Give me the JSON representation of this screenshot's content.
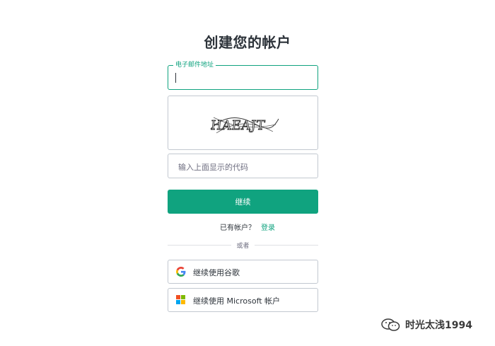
{
  "page": {
    "title": "创建您的帐户"
  },
  "email": {
    "label": "电子邮件地址",
    "value": ""
  },
  "captcha": {
    "text": "HAEAJT"
  },
  "code": {
    "placeholder": "输入上面显示的代码"
  },
  "actions": {
    "continue_label": "继续",
    "have_account_text": "已有帐户？",
    "login_label": "登录"
  },
  "divider": {
    "label": "或者"
  },
  "social": {
    "google_label": "继续使用谷歌",
    "microsoft_label": "继续使用 Microsoft 帐户"
  },
  "watermark": {
    "text": "时光太浅1994"
  },
  "colors": {
    "accent": "#10a37f",
    "border": "#c2c8d0",
    "text": "#2d333a"
  },
  "icons": {
    "google": "google-logo-icon",
    "microsoft": "microsoft-logo-icon",
    "watermark": "wechat-icon"
  }
}
